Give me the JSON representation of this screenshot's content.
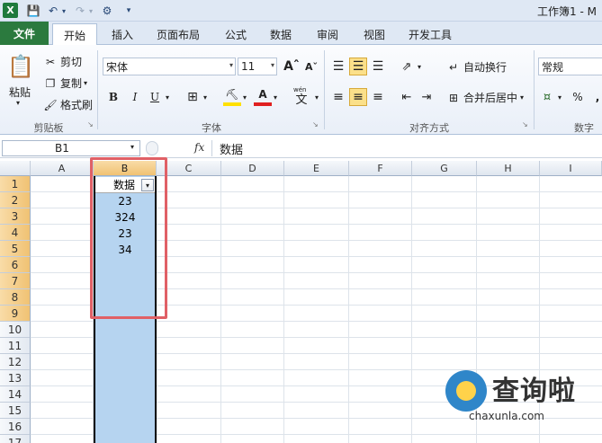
{
  "window": {
    "title": "工作簿1 - M"
  },
  "quick_access": {
    "icons": [
      "excel-logo",
      "save-icon",
      "undo-icon",
      "redo-icon",
      "customize-icon"
    ]
  },
  "tabs": [
    {
      "label": "文件"
    },
    {
      "label": "开始"
    },
    {
      "label": "插入"
    },
    {
      "label": "页面布局"
    },
    {
      "label": "公式"
    },
    {
      "label": "数据"
    },
    {
      "label": "审阅"
    },
    {
      "label": "视图"
    },
    {
      "label": "开发工具"
    }
  ],
  "clipboard": {
    "paste": "粘贴",
    "cut": "剪切",
    "copy": "复制",
    "format_painter": "格式刷",
    "group_label": "剪贴板"
  },
  "font": {
    "name": "宋体",
    "size": "11",
    "bold": "B",
    "italic": "I",
    "underline": "U",
    "wen": "wén",
    "group_label": "字体"
  },
  "alignment": {
    "wrap_text": "自动换行",
    "merge_center": "合并后居中",
    "group_label": "对齐方式"
  },
  "number": {
    "format": "常规",
    "percent": "%",
    "comma": ",",
    "group_label": "数字"
  },
  "formula_bar": {
    "name_box": "B1",
    "fx": "fx",
    "content": "数据"
  },
  "grid": {
    "columns": [
      "A",
      "B",
      "C",
      "D",
      "E",
      "F",
      "G",
      "H",
      "I"
    ],
    "selected_column": "B",
    "rows": [
      "1",
      "2",
      "3",
      "4",
      "5",
      "6",
      "7",
      "8",
      "9",
      "10",
      "11",
      "12",
      "13",
      "14",
      "15",
      "16",
      "17"
    ],
    "column_b": [
      "数据",
      "23",
      "324",
      "23",
      "34"
    ]
  },
  "watermark": {
    "text": "查询啦",
    "url": "chaxunla.com"
  },
  "colors": {
    "file_tab": "#2b7a3e",
    "selection_fill": "#b6d4f0",
    "highlight_box": "#e06066"
  }
}
